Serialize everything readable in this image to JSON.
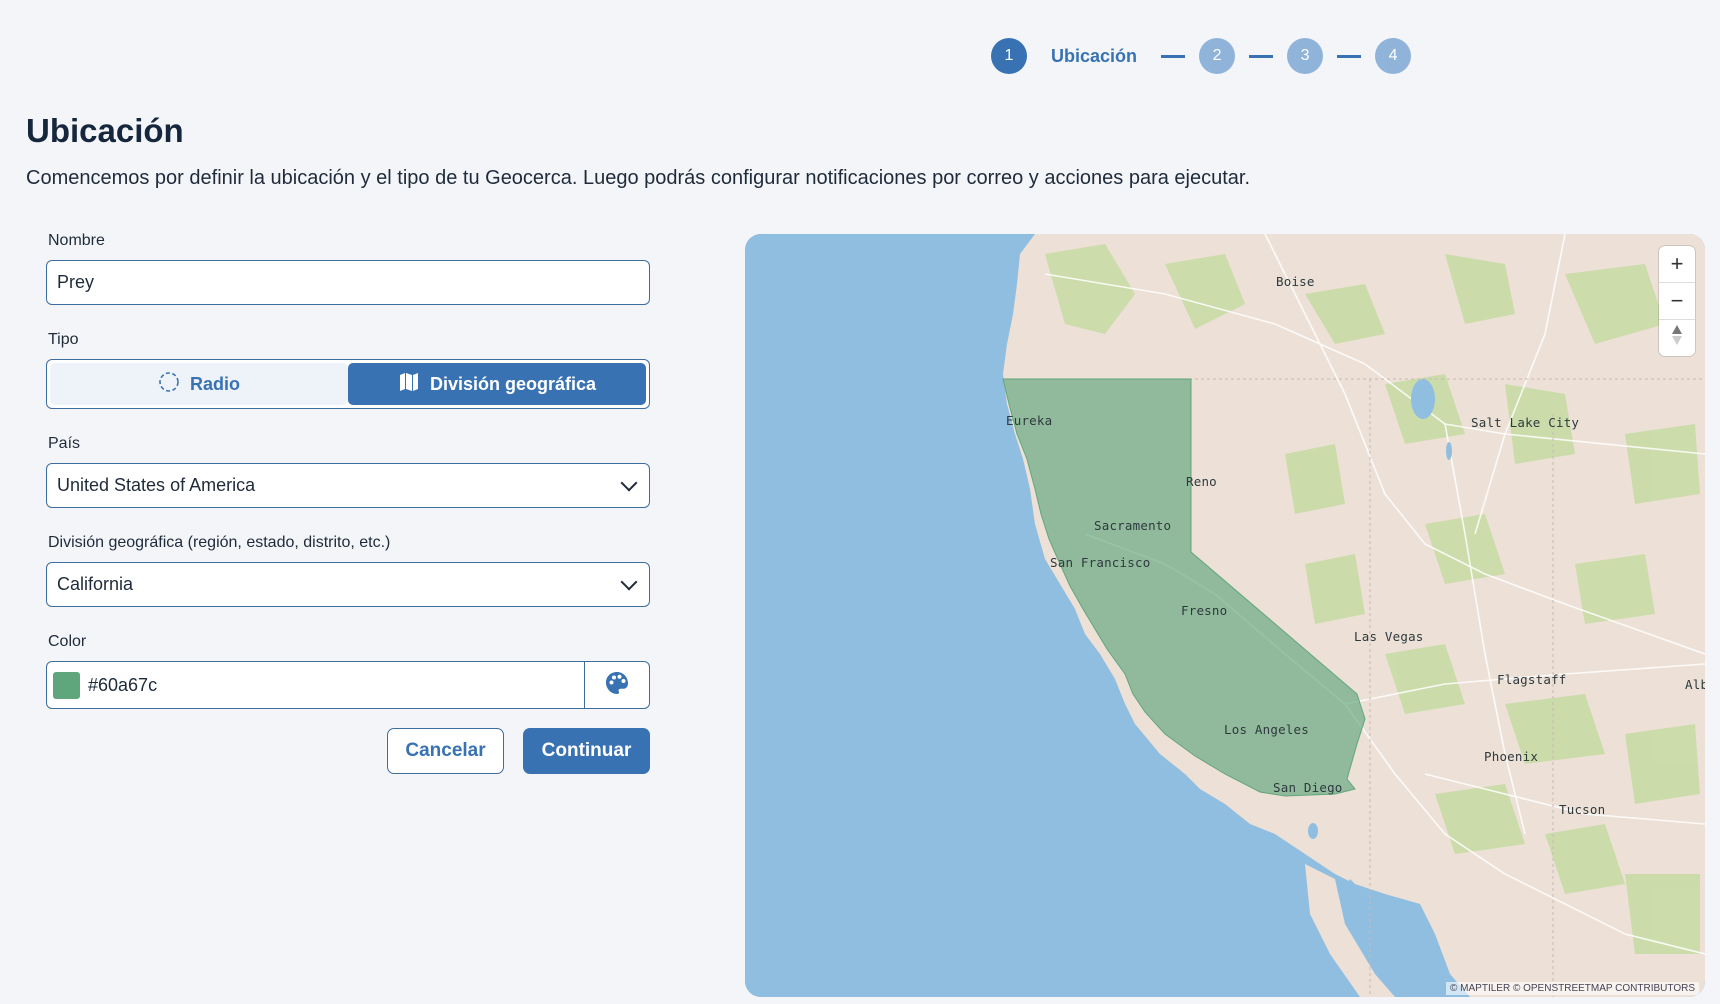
{
  "stepper": {
    "steps": [
      {
        "number": "1",
        "label": "Ubicación",
        "active": true
      },
      {
        "number": "2"
      },
      {
        "number": "3"
      },
      {
        "number": "4"
      }
    ]
  },
  "page": {
    "title": "Ubicación",
    "description": "Comencemos por definir la ubicación y el tipo de tu Geocerca. Luego podrás configurar notificaciones por correo y acciones para ejecutar."
  },
  "form": {
    "name_label": "Nombre",
    "name_value": "Prey",
    "type_label": "Tipo",
    "type_options": [
      {
        "label": "Radio",
        "icon": "circle-dashed-icon",
        "selected": false
      },
      {
        "label": "División geográfica",
        "icon": "map-icon",
        "selected": true
      }
    ],
    "country_label": "País",
    "country_value": "United States of America",
    "division_label": "División geográfica (región, estado, distrito, etc.)",
    "division_value": "California",
    "color_label": "Color",
    "color_value": "#60a67c",
    "cancel_label": "Cancelar",
    "continue_label": "Continuar"
  },
  "map": {
    "highlight_color": "#60a67c",
    "labels": {
      "boise": "Boise",
      "eureka": "Eureka",
      "salt_lake_city": "Salt Lake City",
      "reno": "Reno",
      "sacramento": "Sacramento",
      "san_francisco": "San Francisco",
      "fresno": "Fresno",
      "las_vegas": "Las Vegas",
      "flagstaff": "Flagstaff",
      "alb": "Alb",
      "los_angeles": "Los Angeles",
      "phoenix": "Phoenix",
      "san_diego": "San Diego",
      "tucson": "Tucson"
    },
    "zoom_in": "+",
    "zoom_out": "−",
    "attribution": "© MAPTILER © OPENSTREETMAP CONTRIBUTORS"
  },
  "colors": {
    "accent": "#3872b3",
    "accent_light": "#8fb3d9",
    "water": "#90bee0",
    "land": "#ede0d6",
    "vegetation": "#c8dca6"
  }
}
